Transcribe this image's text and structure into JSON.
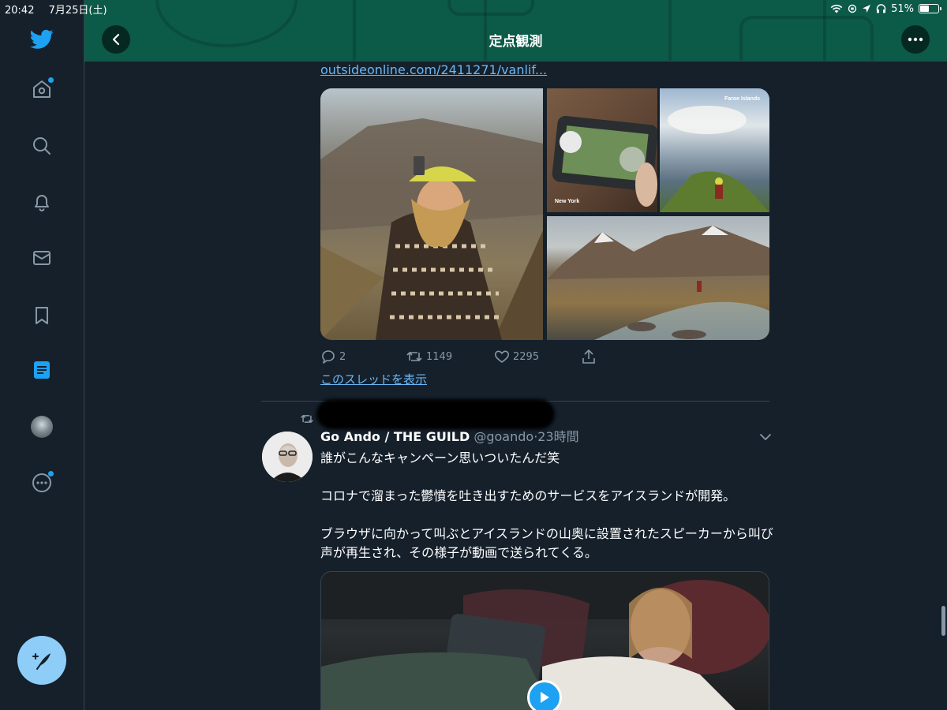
{
  "status_bar": {
    "time": "20:42",
    "date": "7月25日(土)",
    "battery": "51%",
    "battery_level": 0.51
  },
  "sidebar": {
    "items": [
      {
        "icon": "twitter-bird-icon"
      },
      {
        "icon": "home-icon",
        "notification_dot": true
      },
      {
        "icon": "search-icon"
      },
      {
        "icon": "bell-icon"
      },
      {
        "icon": "mail-icon"
      },
      {
        "icon": "bookmark-icon"
      },
      {
        "icon": "lists-icon",
        "active": true
      },
      {
        "icon": "profile-avatar"
      },
      {
        "icon": "more-icon",
        "notification_dot": true
      }
    ],
    "compose_icon": "compose-feather-icon"
  },
  "header": {
    "title": "定点観測",
    "back_icon": "chevron-left-icon",
    "more_icon": "more-dots-icon"
  },
  "previous_tweet": {
    "link_text": "outsideonline.com/2411271/vanlif...",
    "media_labels": {
      "phone_photo": "New York",
      "landscape_photo": "Faroe Islands"
    },
    "actions": {
      "replies": "2",
      "retweets": "1149",
      "likes": "2295"
    },
    "thread_link": "このスレッドを表示"
  },
  "tweet": {
    "display_name": "Go Ando / THE GUILD",
    "handle": "@goando",
    "separator": "·",
    "time": "23時間",
    "paragraphs": [
      "誰がこんなキャンペーン思いついたんだ笑",
      "コロナで溜まった鬱憤を吐き出すためのサービスをアイスランドが開発。",
      "ブラウザに向かって叫ぶとアイスランドの山奥に設置されたスピーカーから叫び声が再生され、その様子が動画で送られてくる。"
    ]
  },
  "colors": {
    "background": "#15202b",
    "header": "#0c5a48",
    "accent": "#1da1f2",
    "link": "#6ab7f4",
    "muted": "#8899a6",
    "compose": "#8ecdf8"
  }
}
